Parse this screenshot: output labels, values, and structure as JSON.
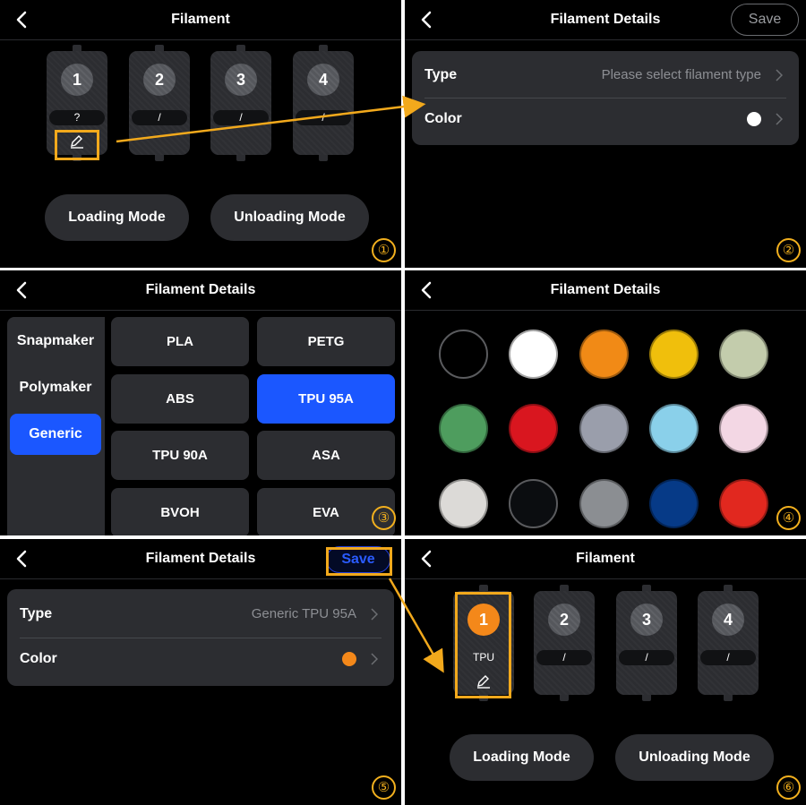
{
  "panels": {
    "p1": {
      "title": "Filament",
      "slots": [
        {
          "num": "1",
          "label": "?"
        },
        {
          "num": "2",
          "label": "/"
        },
        {
          "num": "3",
          "label": "/"
        },
        {
          "num": "4",
          "label": "/"
        }
      ],
      "loading": "Loading Mode",
      "unloading": "Unloading Mode",
      "step": "①"
    },
    "p2": {
      "title": "Filament Details",
      "save": "Save",
      "type_label": "Type",
      "type_value": "Please select filament type",
      "color_label": "Color",
      "color_value": "#ffffff",
      "step": "②"
    },
    "p3": {
      "title": "Filament Details",
      "brands": [
        "Snapmaker",
        "Polymaker",
        "Generic"
      ],
      "selected_brand": "Generic",
      "materials": [
        "PLA",
        "PETG",
        "ABS",
        "TPU 95A",
        "TPU 90A",
        "ASA",
        "BVOH",
        "EVA"
      ],
      "selected_material": "TPU 95A",
      "step": "③"
    },
    "p4": {
      "title": "Filament Details",
      "swatches": [
        "#000000",
        "#ffffff",
        "#f18a16",
        "#f0bf0c",
        "#c3ccac",
        "#4e9d5e",
        "#d9161f",
        "#9a9eab",
        "#8ad0ea",
        "#f3d7e4",
        "#dcdad7",
        "#0b0d10",
        "#8b8e92",
        "#063a87",
        "#e1281f"
      ],
      "step": "④"
    },
    "p5": {
      "title": "Filament Details",
      "save": "Save",
      "type_label": "Type",
      "type_value": "Generic TPU 95A",
      "color_label": "Color",
      "color_value": "#f4881a",
      "step": "⑤"
    },
    "p6": {
      "title": "Filament",
      "slots": [
        {
          "num": "1",
          "label": "TPU"
        },
        {
          "num": "2",
          "label": "/"
        },
        {
          "num": "3",
          "label": "/"
        },
        {
          "num": "4",
          "label": "/"
        }
      ],
      "loading": "Loading Mode",
      "unloading": "Unloading Mode",
      "step": "⑥"
    }
  },
  "colors": {
    "accent_orange": "#f2a91c",
    "selected_blue": "#1b57ff",
    "card": "#2c2d31"
  }
}
